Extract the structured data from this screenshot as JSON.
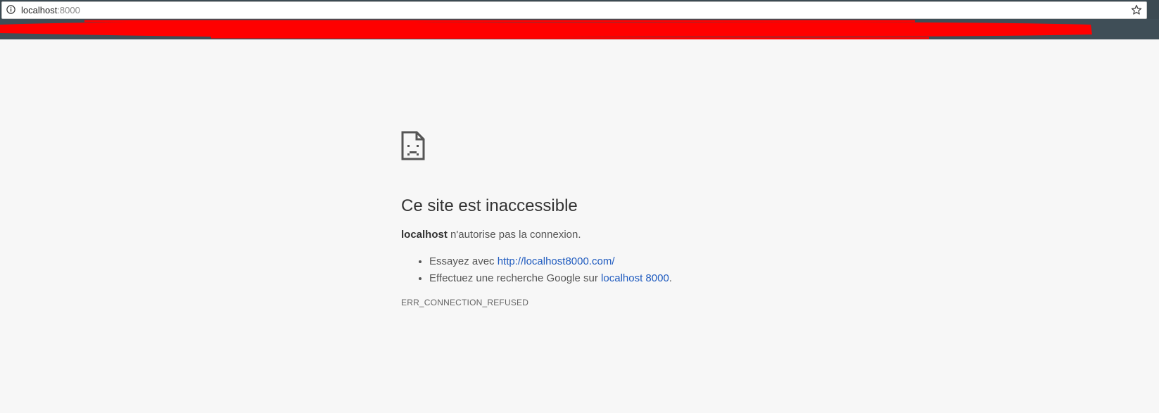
{
  "browser": {
    "url_host": "localhost",
    "url_port": ":8000",
    "icons": {
      "site_info": "info-circle-icon",
      "bookmark": "star-outline-icon"
    }
  },
  "error_page": {
    "icon": "sad-document-icon",
    "title": "Ce site est inaccessible",
    "summary_host": "localhost",
    "summary_text": " n'autorise pas la connexion.",
    "suggestions": [
      {
        "prefix": "Essayez avec ",
        "link": "http://localhost8000.com/",
        "suffix": ""
      },
      {
        "prefix": "Effectuez une recherche Google sur ",
        "link": "localhost 8000",
        "suffix": "."
      }
    ],
    "error_code": "ERR_CONNECTION_REFUSED"
  },
  "colors": {
    "link": "#1f5bbf",
    "page_bg": "#f7f7f7",
    "redaction": "#ff0000"
  }
}
